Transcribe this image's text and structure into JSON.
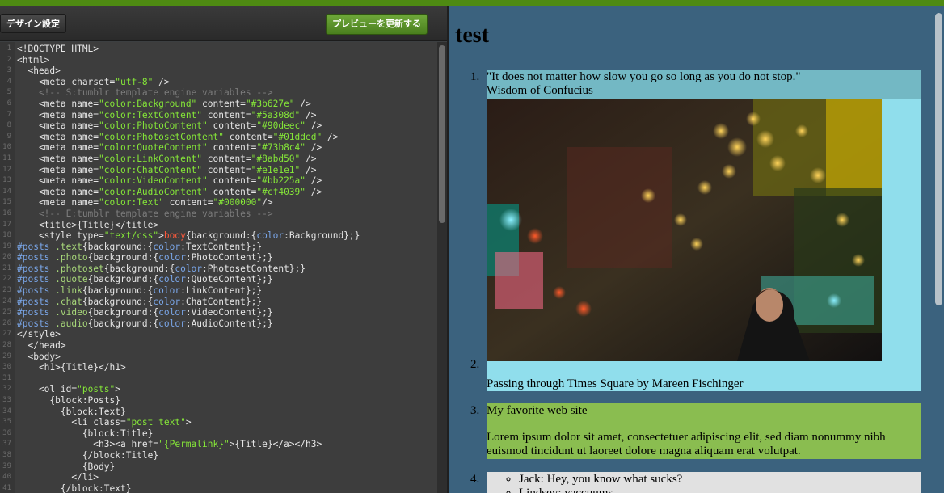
{
  "toolbar": {
    "design_settings_label": "デザイン設定",
    "update_preview_label": "プレビューを更新する"
  },
  "code_lines": [
    [
      {
        "t": "<!DOCTYPE HTML>",
        "c": ""
      }
    ],
    [
      {
        "t": "<html>",
        "c": ""
      }
    ],
    [
      {
        "t": "  <head>",
        "c": ""
      }
    ],
    [
      {
        "t": "    <meta charset=",
        "c": ""
      },
      {
        "t": "\"utf-8\"",
        "c": "c-s"
      },
      {
        "t": " />",
        "c": ""
      }
    ],
    [
      {
        "t": "    <!-- S:tumblr template engine variables -->",
        "c": "c-c"
      }
    ],
    [
      {
        "t": "    <meta name=",
        "c": ""
      },
      {
        "t": "\"color:Background\"",
        "c": "c-s"
      },
      {
        "t": " content=",
        "c": ""
      },
      {
        "t": "\"#3b627e\"",
        "c": "c-s"
      },
      {
        "t": " />",
        "c": ""
      }
    ],
    [
      {
        "t": "    <meta name=",
        "c": ""
      },
      {
        "t": "\"color:TextContent\"",
        "c": "c-s"
      },
      {
        "t": " content=",
        "c": ""
      },
      {
        "t": "\"#5a308d\"",
        "c": "c-s"
      },
      {
        "t": " />",
        "c": ""
      }
    ],
    [
      {
        "t": "    <meta name=",
        "c": ""
      },
      {
        "t": "\"color:PhotoContent\"",
        "c": "c-s"
      },
      {
        "t": " content=",
        "c": ""
      },
      {
        "t": "\"#90deec\"",
        "c": "c-s"
      },
      {
        "t": " />",
        "c": ""
      }
    ],
    [
      {
        "t": "    <meta name=",
        "c": ""
      },
      {
        "t": "\"color:PhotosetContent\"",
        "c": "c-s"
      },
      {
        "t": " content=",
        "c": ""
      },
      {
        "t": "\"#01dded\"",
        "c": "c-s"
      },
      {
        "t": " />",
        "c": ""
      }
    ],
    [
      {
        "t": "    <meta name=",
        "c": ""
      },
      {
        "t": "\"color:QuoteContent\"",
        "c": "c-s"
      },
      {
        "t": " content=",
        "c": ""
      },
      {
        "t": "\"#73b8c4\"",
        "c": "c-s"
      },
      {
        "t": " />",
        "c": ""
      }
    ],
    [
      {
        "t": "    <meta name=",
        "c": ""
      },
      {
        "t": "\"color:LinkContent\"",
        "c": "c-s"
      },
      {
        "t": " content=",
        "c": ""
      },
      {
        "t": "\"#8abd50\"",
        "c": "c-s"
      },
      {
        "t": " />",
        "c": ""
      }
    ],
    [
      {
        "t": "    <meta name=",
        "c": ""
      },
      {
        "t": "\"color:ChatContent\"",
        "c": "c-s"
      },
      {
        "t": " content=",
        "c": ""
      },
      {
        "t": "\"#e1e1e1\"",
        "c": "c-s"
      },
      {
        "t": " />",
        "c": ""
      }
    ],
    [
      {
        "t": "    <meta name=",
        "c": ""
      },
      {
        "t": "\"color:VideoContent\"",
        "c": "c-s"
      },
      {
        "t": " content=",
        "c": ""
      },
      {
        "t": "\"#bb225a\"",
        "c": "c-s"
      },
      {
        "t": " />",
        "c": ""
      }
    ],
    [
      {
        "t": "    <meta name=",
        "c": ""
      },
      {
        "t": "\"color:AudioContent\"",
        "c": "c-s"
      },
      {
        "t": " content=",
        "c": ""
      },
      {
        "t": "\"#cf4039\"",
        "c": "c-s"
      },
      {
        "t": " />",
        "c": ""
      }
    ],
    [
      {
        "t": "    <meta name=",
        "c": ""
      },
      {
        "t": "\"color:Text\"",
        "c": "c-s"
      },
      {
        "t": " content=",
        "c": ""
      },
      {
        "t": "\"#000000\"",
        "c": "c-s"
      },
      {
        "t": "/>",
        "c": ""
      }
    ],
    [
      {
        "t": "    <!-- E:tumblr template engine variables -->",
        "c": "c-c"
      }
    ],
    [
      {
        "t": "    <title>{Title}</title>",
        "c": ""
      }
    ],
    [
      {
        "t": "    <style type=",
        "c": ""
      },
      {
        "t": "\"text/css\"",
        "c": "c-s"
      },
      {
        "t": ">",
        "c": ""
      },
      {
        "t": "body",
        "c": "c-sel"
      },
      {
        "t": "{background:{",
        "c": ""
      },
      {
        "t": "color",
        "c": "c-p"
      },
      {
        "t": ":Background};}",
        "c": ""
      }
    ],
    [
      {
        "t": "#posts ",
        "c": "c-p"
      },
      {
        "t": ".text",
        "c": "c-cls"
      },
      {
        "t": "{background:{",
        "c": ""
      },
      {
        "t": "color",
        "c": "c-p"
      },
      {
        "t": ":TextContent};}",
        "c": ""
      }
    ],
    [
      {
        "t": "#posts ",
        "c": "c-p"
      },
      {
        "t": ".photo",
        "c": "c-cls"
      },
      {
        "t": "{background:{",
        "c": ""
      },
      {
        "t": "color",
        "c": "c-p"
      },
      {
        "t": ":PhotoContent};}",
        "c": ""
      }
    ],
    [
      {
        "t": "#posts ",
        "c": "c-p"
      },
      {
        "t": ".photoset",
        "c": "c-cls"
      },
      {
        "t": "{background:{",
        "c": ""
      },
      {
        "t": "color",
        "c": "c-p"
      },
      {
        "t": ":PhotosetContent};}",
        "c": ""
      }
    ],
    [
      {
        "t": "#posts ",
        "c": "c-p"
      },
      {
        "t": ".quote",
        "c": "c-cls"
      },
      {
        "t": "{background:{",
        "c": ""
      },
      {
        "t": "color",
        "c": "c-p"
      },
      {
        "t": ":QuoteContent};}",
        "c": ""
      }
    ],
    [
      {
        "t": "#posts ",
        "c": "c-p"
      },
      {
        "t": ".link",
        "c": "c-cls"
      },
      {
        "t": "{background:{",
        "c": ""
      },
      {
        "t": "color",
        "c": "c-p"
      },
      {
        "t": ":LinkContent};}",
        "c": ""
      }
    ],
    [
      {
        "t": "#posts ",
        "c": "c-p"
      },
      {
        "t": ".chat",
        "c": "c-cls"
      },
      {
        "t": "{background:{",
        "c": ""
      },
      {
        "t": "color",
        "c": "c-p"
      },
      {
        "t": ":ChatContent};}",
        "c": ""
      }
    ],
    [
      {
        "t": "#posts ",
        "c": "c-p"
      },
      {
        "t": ".video",
        "c": "c-cls"
      },
      {
        "t": "{background:{",
        "c": ""
      },
      {
        "t": "color",
        "c": "c-p"
      },
      {
        "t": ":VideoContent};}",
        "c": ""
      }
    ],
    [
      {
        "t": "#posts ",
        "c": "c-p"
      },
      {
        "t": ".audio",
        "c": "c-cls"
      },
      {
        "t": "{background:{",
        "c": ""
      },
      {
        "t": "color",
        "c": "c-p"
      },
      {
        "t": ":AudioContent};}",
        "c": ""
      }
    ],
    [
      {
        "t": "</style>",
        "c": ""
      }
    ],
    [
      {
        "t": "  </head>",
        "c": ""
      }
    ],
    [
      {
        "t": "  <body>",
        "c": ""
      }
    ],
    [
      {
        "t": "    <h1>{Title}</h1>",
        "c": ""
      }
    ],
    [
      {
        "t": "",
        "c": ""
      }
    ],
    [
      {
        "t": "    <ol id=",
        "c": ""
      },
      {
        "t": "\"posts\"",
        "c": "c-s"
      },
      {
        "t": ">",
        "c": ""
      }
    ],
    [
      {
        "t": "      {block:Posts}",
        "c": ""
      }
    ],
    [
      {
        "t": "        {block:Text}",
        "c": ""
      }
    ],
    [
      {
        "t": "          <li class=",
        "c": ""
      },
      {
        "t": "\"post text\"",
        "c": "c-s"
      },
      {
        "t": ">",
        "c": ""
      }
    ],
    [
      {
        "t": "            {block:Title}",
        "c": ""
      }
    ],
    [
      {
        "t": "              <h3><a href=",
        "c": ""
      },
      {
        "t": "\"{Permalink}\"",
        "c": "c-s"
      },
      {
        "t": ">{Title}</a></h3>",
        "c": ""
      }
    ],
    [
      {
        "t": "            {/block:Title}",
        "c": ""
      }
    ],
    [
      {
        "t": "            {Body}",
        "c": ""
      }
    ],
    [
      {
        "t": "          </li>",
        "c": ""
      }
    ],
    [
      {
        "t": "        {/block:Text}",
        "c": ""
      }
    ]
  ],
  "preview": {
    "blog_title": "test",
    "posts": {
      "quote": {
        "number": "1.",
        "text": "\"It does not matter how slow you go so long as you do not stop.\"",
        "source": "Wisdom of Confucius",
        "color": "#73b8c4"
      },
      "photo": {
        "number": "2.",
        "caption": "Passing through Times Square by Mareen Fischinger",
        "color": "#90deec"
      },
      "link": {
        "number": "3.",
        "title": "My favorite web site",
        "body": "Lorem ipsum dolor sit amet, consectetuer adipiscing elit, sed diam nonummy nibh euismod tincidunt ut laoreet dolore magna aliquam erat volutpat.",
        "color": "#8abd50"
      },
      "chat": {
        "number": "4.",
        "lines": [
          "Jack: Hey, you know what sucks?",
          "Lindsey: vaccuums"
        ],
        "color": "#e1e1e1"
      }
    },
    "background_color": "#3b627e"
  }
}
